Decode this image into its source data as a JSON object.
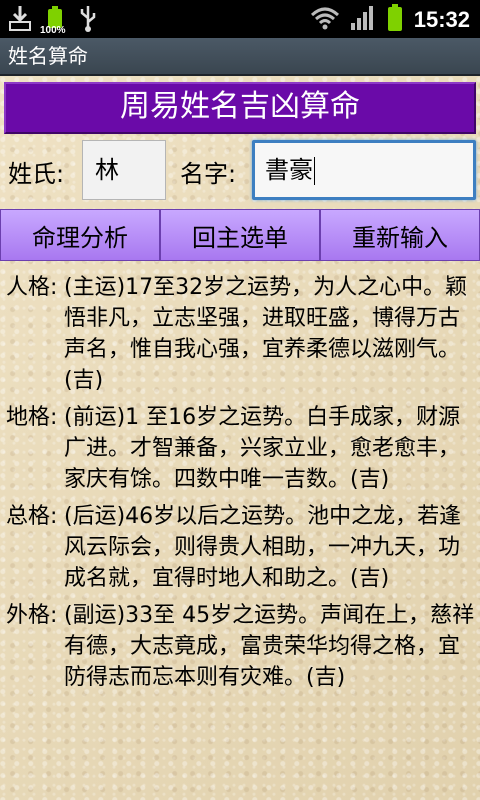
{
  "status_bar": {
    "time": "15:32",
    "battery_small_label": "100%",
    "icons": [
      "download-icon",
      "battery-icon",
      "usb-icon",
      "wifi-icon",
      "signal-icon",
      "battery-full-icon"
    ],
    "battery_color": "#7fd100"
  },
  "window": {
    "title": "姓名算命"
  },
  "app": {
    "header_title": "周易姓名吉凶算命",
    "header_color": "#6a0aa8"
  },
  "form": {
    "surname_label": "姓氏:",
    "surname_value": "林",
    "given_label": "名字:",
    "given_value": "書豪"
  },
  "buttons": {
    "analyze": "命理分析",
    "back_main": "回主选单",
    "reset": "重新输入"
  },
  "results": [
    {
      "label": "人格:",
      "text": "(主运)17至32岁之运势，为人之心中。颖悟非凡，立志坚强，进取旺盛，博得万古声名，惟自我心强，宜养柔德以滋刚气。(吉)"
    },
    {
      "label": "地格:",
      "text": "(前运)1 至16岁之运势。白手成家，财源广进。才智兼备，兴家立业，愈老愈丰，家庆有馀。四数中唯一吉数。(吉)"
    },
    {
      "label": "总格:",
      "text": "(后运)46岁以后之运势。池中之龙，若逢风云际会，则得贵人相助，一冲九天，功成名就，宜得时地人和助之。(吉)"
    },
    {
      "label": "外格:",
      "text": "(副运)33至 45岁之运势。声闻在上，慈祥有德，大志竟成，富贵荣华均得之格，宜防得志而忘本则有灾难。(吉)"
    }
  ]
}
